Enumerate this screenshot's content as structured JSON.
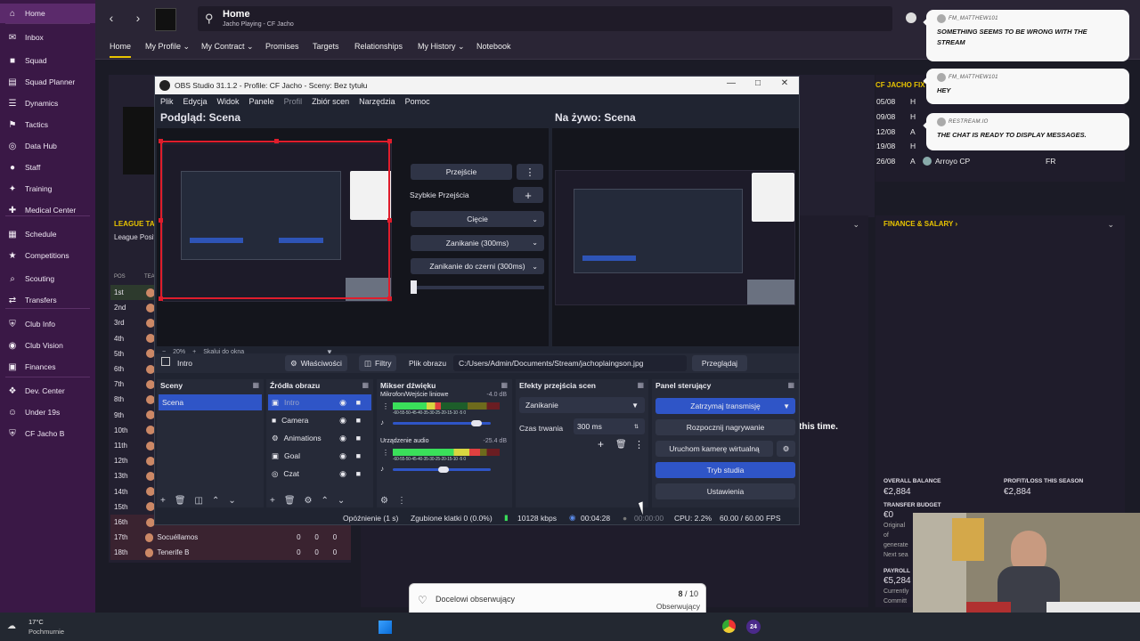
{
  "sidebar": {
    "items": [
      {
        "label": "Home",
        "icon": "home-icon",
        "active": true
      },
      {
        "label": "Inbox",
        "icon": "inbox-icon"
      },
      {
        "label": "Squad",
        "icon": "shirt-icon"
      },
      {
        "label": "Squad Planner",
        "icon": "planner-icon"
      },
      {
        "label": "Dynamics",
        "icon": "dynamics-icon"
      },
      {
        "label": "Tactics",
        "icon": "tactics-icon"
      },
      {
        "label": "Data Hub",
        "icon": "data-hub-icon"
      },
      {
        "label": "Staff",
        "icon": "staff-icon"
      },
      {
        "label": "Training",
        "icon": "training-icon"
      },
      {
        "label": "Medical Center",
        "icon": "medical-icon"
      },
      {
        "label": "Schedule",
        "icon": "calendar-icon"
      },
      {
        "label": "Competitions",
        "icon": "trophy-icon"
      },
      {
        "label": "Scouting",
        "icon": "scouting-icon"
      },
      {
        "label": "Transfers",
        "icon": "transfers-icon"
      },
      {
        "label": "Club Info",
        "icon": "shield-icon"
      },
      {
        "label": "Club Vision",
        "icon": "vision-icon"
      },
      {
        "label": "Finances",
        "icon": "finances-icon"
      },
      {
        "label": "Dev. Center",
        "icon": "dev-center-icon"
      },
      {
        "label": "Under 19s",
        "icon": "u19-icon"
      },
      {
        "label": "CF Jacho B",
        "icon": "b-team-icon"
      }
    ]
  },
  "header": {
    "title": "Home",
    "subtitle": "Jacho Playing - CF Jacho",
    "tabs": [
      {
        "label": "Home",
        "active": true
      },
      {
        "label": "My Profile ⌄"
      },
      {
        "label": "My Contract ⌄"
      },
      {
        "label": "Promises"
      },
      {
        "label": "Targets"
      },
      {
        "label": "Relationships"
      },
      {
        "label": "My History ⌄"
      },
      {
        "label": "Notebook"
      }
    ]
  },
  "fm_content": {
    "league_title": "LEAGUE TA",
    "league_subtitle": "League Posit",
    "col_pos": "POS",
    "col_team": "TEA",
    "league_rows": [
      {
        "pos": "1st"
      },
      {
        "pos": "2nd"
      },
      {
        "pos": "3rd"
      },
      {
        "pos": "4th"
      },
      {
        "pos": "5th"
      },
      {
        "pos": "6th"
      },
      {
        "pos": "7th"
      },
      {
        "pos": "8th"
      },
      {
        "pos": "9th"
      },
      {
        "pos": "10th"
      },
      {
        "pos": "11th"
      },
      {
        "pos": "12th"
      },
      {
        "pos": "13th"
      },
      {
        "pos": "14th"
      },
      {
        "pos": "15th"
      },
      {
        "pos": "16th"
      },
      {
        "pos": "17th",
        "team": "Socuéllamos",
        "a": "0",
        "b": "0",
        "c": "0"
      },
      {
        "pos": "18th",
        "team": "Tenerife B",
        "a": "0",
        "b": "0",
        "c": "0"
      }
    ],
    "fixtures_title": "CF JACHO FIX",
    "fixtures": [
      {
        "date": "05/08",
        "venue": "H",
        "team": "",
        "comp": ""
      },
      {
        "date": "09/08",
        "venue": "H",
        "team": "",
        "comp": ""
      },
      {
        "date": "12/08",
        "venue": "A",
        "team": "",
        "comp": ""
      },
      {
        "date": "19/08",
        "venue": "H",
        "team": "",
        "comp": ""
      },
      {
        "date": "26/08",
        "venue": "A",
        "team": "Arroyo CP",
        "comp": "FR"
      }
    ],
    "finance_title": "FINANCE & SALARY ›",
    "this_time": "this time.",
    "overall_balance_label": "OVERALL BALANCE",
    "overall_balance_value": "€2,884",
    "profit_label": "PROFIT/LOSS THIS SEASON",
    "profit_value": "€2,884",
    "transfer_budget_label": "TRANSFER BUDGET",
    "transfer_budget_value": "€0",
    "tb_note1": "Original",
    "tb_note2": "of",
    "tb_note3": "generate",
    "tb_note4": "Next sea",
    "payroll_label": "PAYROLL",
    "payroll_value": "€5,284",
    "payroll_note1": "Currently",
    "payroll_note2": "Committ"
  },
  "obs": {
    "window_title": "OBS Studio 31.1.2 - Profile: CF Jacho - Sceny: Bez tytułu",
    "menu": [
      "Plik",
      "Edycja",
      "Widok",
      "Panele",
      "Profil",
      "Zbiór scen",
      "Narzędzia",
      "Pomoc"
    ],
    "preview_heading": "Podgląd: Scena",
    "program_heading": "Na żywo: Scena",
    "transition_button": "Przejście",
    "quick_transitions": "Szybkie Przejścia",
    "quick_items": [
      "Cięcie",
      "Zanikanie (300ms)",
      "Zanikanie do czerni (300ms)"
    ],
    "zoom_text": "20%",
    "scale_text": "Skaluj do okna",
    "source_name": "Intro",
    "properties_button": "Właściwości",
    "filters_button": "Filtry",
    "image_file_label": "Plik obrazu",
    "image_file_path": "C:/Users/Admin/Documents/Stream/jachoplaingson.jpg",
    "browse_button": "Przeglądaj",
    "scenes_title": "Sceny",
    "scenes": [
      "Scena"
    ],
    "sources_title": "Źródła obrazu",
    "sources": [
      "Intro",
      "Camera",
      "Animations",
      "Goal",
      "Czat"
    ],
    "mixer_title": "Mikser dźwięku",
    "mixer": [
      {
        "name": "Mikrofon/Wejście liniowe",
        "db": "-4.0 dB",
        "level": 0.45,
        "volume": 0.85
      },
      {
        "name": "Urządzenie audio",
        "db": "-25.4 dB",
        "level": 0.82,
        "volume": 0.52
      }
    ],
    "meter_scale": "-60-55-50-45-40-35-30-25-20-15-10 -5  0",
    "transitions_title": "Efekty przejścia scen",
    "transition_select": "Zanikanie",
    "duration_label": "Czas trwania",
    "duration_value": "300 ms",
    "controls_title": "Panel sterujący",
    "controls": [
      "Zatrzymaj transmisję",
      "Rozpocznij nagrywanie",
      "Uruchom kamerę wirtualną",
      "Tryb studia",
      "Ustawienia"
    ],
    "status": {
      "delay": "Opóźnienie (1 s)",
      "dropped": "Zgubione klatki 0 (0.0%)",
      "bitrate": "10128 kbps",
      "stream_time": "00:04:28",
      "rec_time": "00:00:00",
      "cpu": "CPU: 2.2%",
      "fps": "60.00 / 60.00 FPS"
    },
    "colors": {
      "accent": "#2f55c7",
      "selection": "#e01d2c"
    }
  },
  "chat": [
    {
      "user": "FM_MATTHEW101",
      "message": "SOMETHING SEEMS TO BE WRONG WITH THE STREAM"
    },
    {
      "user": "FM_MATTHEW101",
      "message": "HEY"
    },
    {
      "user": "RESTREAM.IO",
      "message": "THE CHAT IS READY TO DISPLAY MESSAGES."
    }
  ],
  "goal": {
    "label": "Docelowi obserwujący",
    "current": "8",
    "total": " / 10",
    "unit": "Obserwujący",
    "progress": 0.8
  },
  "taskbar": {
    "temp": "17°C",
    "weather": "Pochmurnie",
    "badge": "24"
  }
}
